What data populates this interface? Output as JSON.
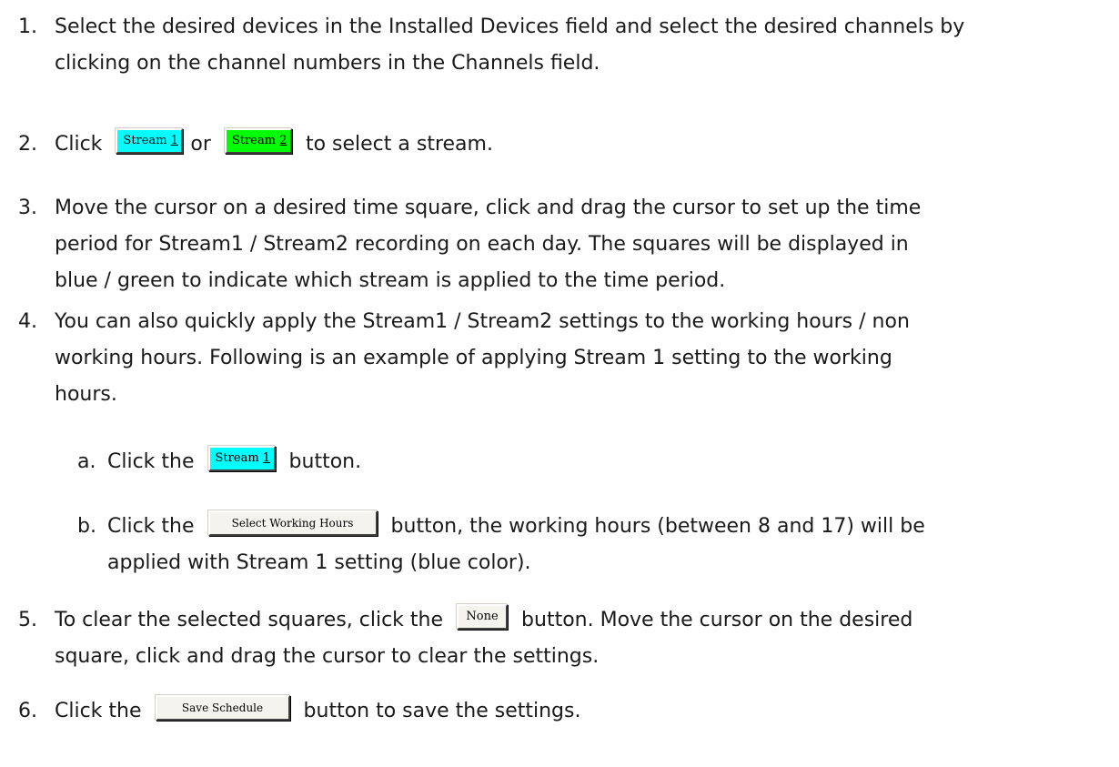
{
  "steps": [
    {
      "num": "1.",
      "lines": [
        "Select the desired devices in the Installed Devices field and select the desired channels by",
        "clicking on the channel numbers in the Channels field."
      ]
    },
    {
      "num": "2.",
      "pre": "Click",
      "mid": "or",
      "post": "to select a stream."
    },
    {
      "num": "3.",
      "lines": [
        "Move the cursor on a desired time square, click and drag the cursor to set up the time",
        "period for Stream1 / Stream2 recording on each day. The squares will be displayed in",
        "blue / green to indicate which stream is applied to the time period."
      ]
    },
    {
      "num": "4.",
      "lines": [
        "You can also quickly apply the Stream1 / Stream2 settings to the working hours / non",
        "working hours. Following is an example of applying Stream 1 setting to the working",
        "hours."
      ]
    },
    {
      "num": "5.",
      "pre": "To clear the selected squares, click the",
      "post": "button. Move the cursor on the desired",
      "line2": "square, click and drag the cursor to clear the settings."
    },
    {
      "num": "6.",
      "pre": "Click the",
      "post": "button to save the settings."
    }
  ],
  "substeps": [
    {
      "num": "a.",
      "pre": "Click the",
      "post": "button."
    },
    {
      "num": "b.",
      "pre": "Click the",
      "post": "button, the working hours (between 8 and 17) will be",
      "line2": "applied with Stream 1 setting (blue color)."
    }
  ],
  "buttons": {
    "stream1": {
      "text": "Stream ",
      "key": "1"
    },
    "stream2": {
      "text": "Stream ",
      "key": "2"
    },
    "select_working_hours": "Select Working Hours",
    "none": "None",
    "save_schedule": "Save Schedule"
  },
  "colors": {
    "stream1": "#00ffff",
    "stream2": "#00ff00"
  }
}
